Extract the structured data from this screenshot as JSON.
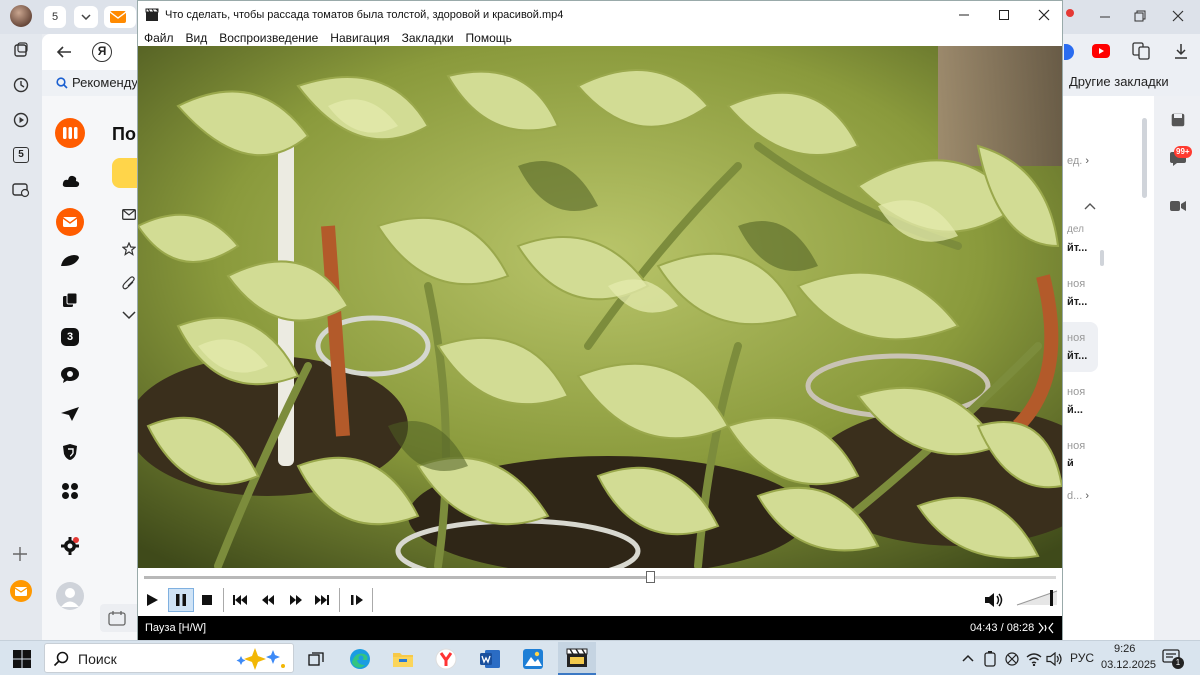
{
  "browser": {
    "tab_count": "5",
    "bookmark_recommend": "Рекомендуе",
    "other_bookmarks": "Другие закладки",
    "mail_heading_partial": "По",
    "badge_99": "99+",
    "sidebar_badge": "5"
  },
  "mail_right": {
    "link_partial_1": "ед.",
    "items": [
      {
        "sender": "дел",
        "subject": "йт..."
      },
      {
        "sender": "ноя",
        "subject": "йт..."
      },
      {
        "sender": "ноя",
        "subject": "йт..."
      },
      {
        "sender": "ноя",
        "subject": "й..."
      },
      {
        "sender": "ноя",
        "subject": "й"
      }
    ],
    "link_partial_2": "d..."
  },
  "player": {
    "title": "Что сделать, чтобы рассада томатов была толстой, здоровой и красивой.mp4",
    "menu": [
      "Файл",
      "Вид",
      "Воспроизведение",
      "Навигация",
      "Закладки",
      "Помощь"
    ],
    "status_text": "Пауза [H/W]",
    "time": "04:43 / 08:28",
    "progress": 0.556,
    "volume": 0.8,
    "state": "paused"
  },
  "taskbar": {
    "search_label": "Поиск",
    "language": "РУС",
    "time": "9:26",
    "date": "03.12.2025",
    "notification_count": "1"
  },
  "colors": {
    "accent_orange": "#ff5c00",
    "mail_yellow": "#ffd54a",
    "player_status_bg": "#000000"
  }
}
